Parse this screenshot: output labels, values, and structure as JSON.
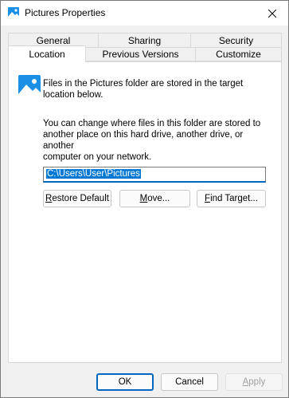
{
  "window": {
    "title": "Pictures Properties"
  },
  "tabs": {
    "row1": [
      "General",
      "Sharing",
      "Security"
    ],
    "row2": [
      "Location",
      "Previous Versions",
      "Customize"
    ],
    "active": "Location"
  },
  "location": {
    "info_line1": "Files in the Pictures folder are stored in the target",
    "info_line2": "location below.",
    "desc_line1": "You can change where files in this folder are stored to",
    "desc_line2": "another place on this hard drive, another drive, or another",
    "desc_line3": "computer on your network.",
    "path_value": "C:\\Users\\User\\Pictures",
    "restore_default": {
      "u": "R",
      "rest": "estore Default"
    },
    "move": {
      "pre": "",
      "u": "M",
      "rest": "ove..."
    },
    "find_target": {
      "u": "F",
      "rest": "ind Target..."
    }
  },
  "footer": {
    "ok": "OK",
    "cancel": "Cancel",
    "apply": {
      "u": "A",
      "rest": "pply"
    }
  },
  "colors": {
    "accent": "#0067c0",
    "selection": "#0078d4",
    "icon_blue": "#1a8fe3"
  }
}
